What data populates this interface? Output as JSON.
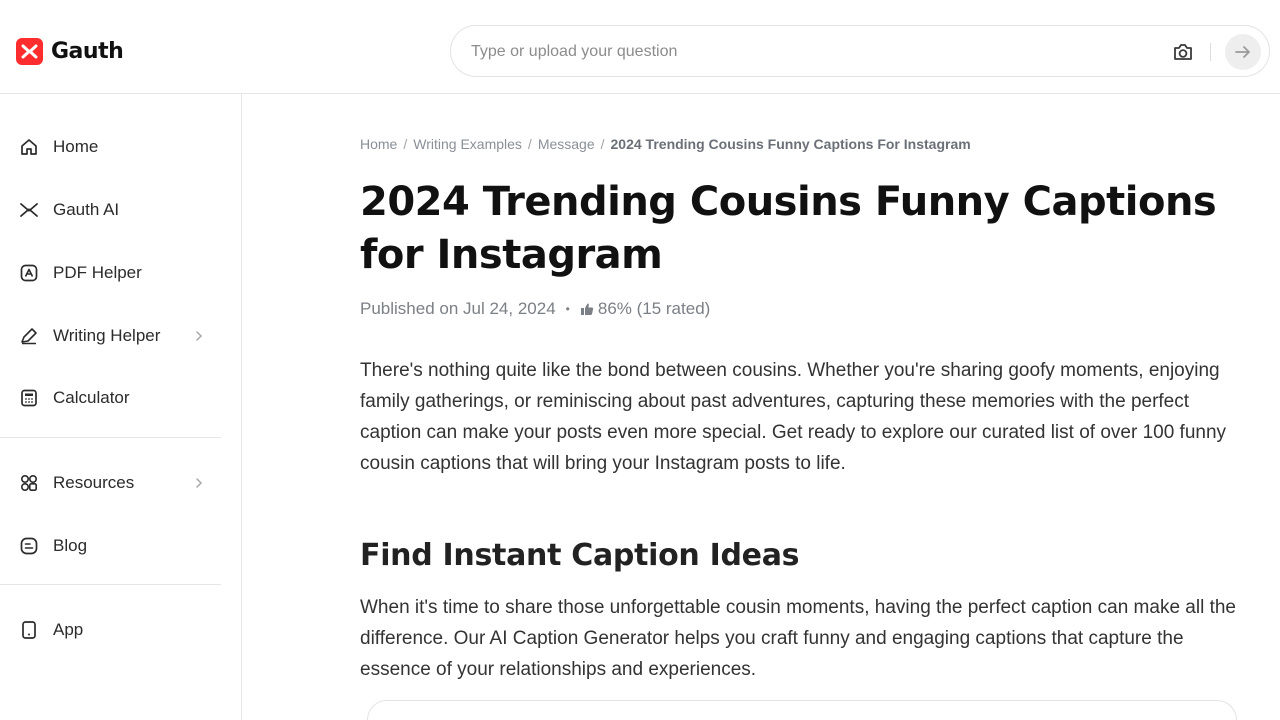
{
  "header": {
    "logo_text": "Gauth",
    "search_placeholder": "Type or upload your question",
    "brand_color": "#ff2d2d"
  },
  "sidebar": {
    "items": [
      {
        "label": "Home",
        "icon": "home-icon"
      },
      {
        "label": "Gauth AI",
        "icon": "gauth-ai-icon"
      },
      {
        "label": "PDF Helper",
        "icon": "pdf-icon"
      },
      {
        "label": "Writing Helper",
        "icon": "pen-icon",
        "has_submenu": true
      },
      {
        "label": "Calculator",
        "icon": "calculator-icon"
      },
      {
        "label": "Resources",
        "icon": "grid-icon",
        "has_submenu": true
      },
      {
        "label": "Blog",
        "icon": "blog-icon"
      },
      {
        "label": "App",
        "icon": "phone-icon"
      }
    ]
  },
  "breadcrumb": {
    "items": [
      "Home",
      "Writing Examples",
      "Message"
    ],
    "separator": "/",
    "current": "2024 Trending Cousins Funny Captions For Instagram"
  },
  "article": {
    "title": "2024 Trending Cousins Funny Captions for Instagram",
    "published": "Published on Jul 24, 2024",
    "rating": "86% (15 rated)",
    "intro": "There's nothing quite like the bond between cousins. Whether you're sharing goofy moments, enjoying family gatherings, or reminiscing about past adventures, capturing these memories with the perfect caption can make your posts even more special. Get ready to explore our curated list of over 100 funny cousin captions that will bring your Instagram posts to life.",
    "section_heading": "Find Instant Caption Ideas",
    "section_text": "When it's time to share those unforgettable cousin moments, having the perfect caption can make all the difference. Our AI Caption Generator helps you craft funny and engaging captions that capture the essence of your relationships and experiences."
  }
}
